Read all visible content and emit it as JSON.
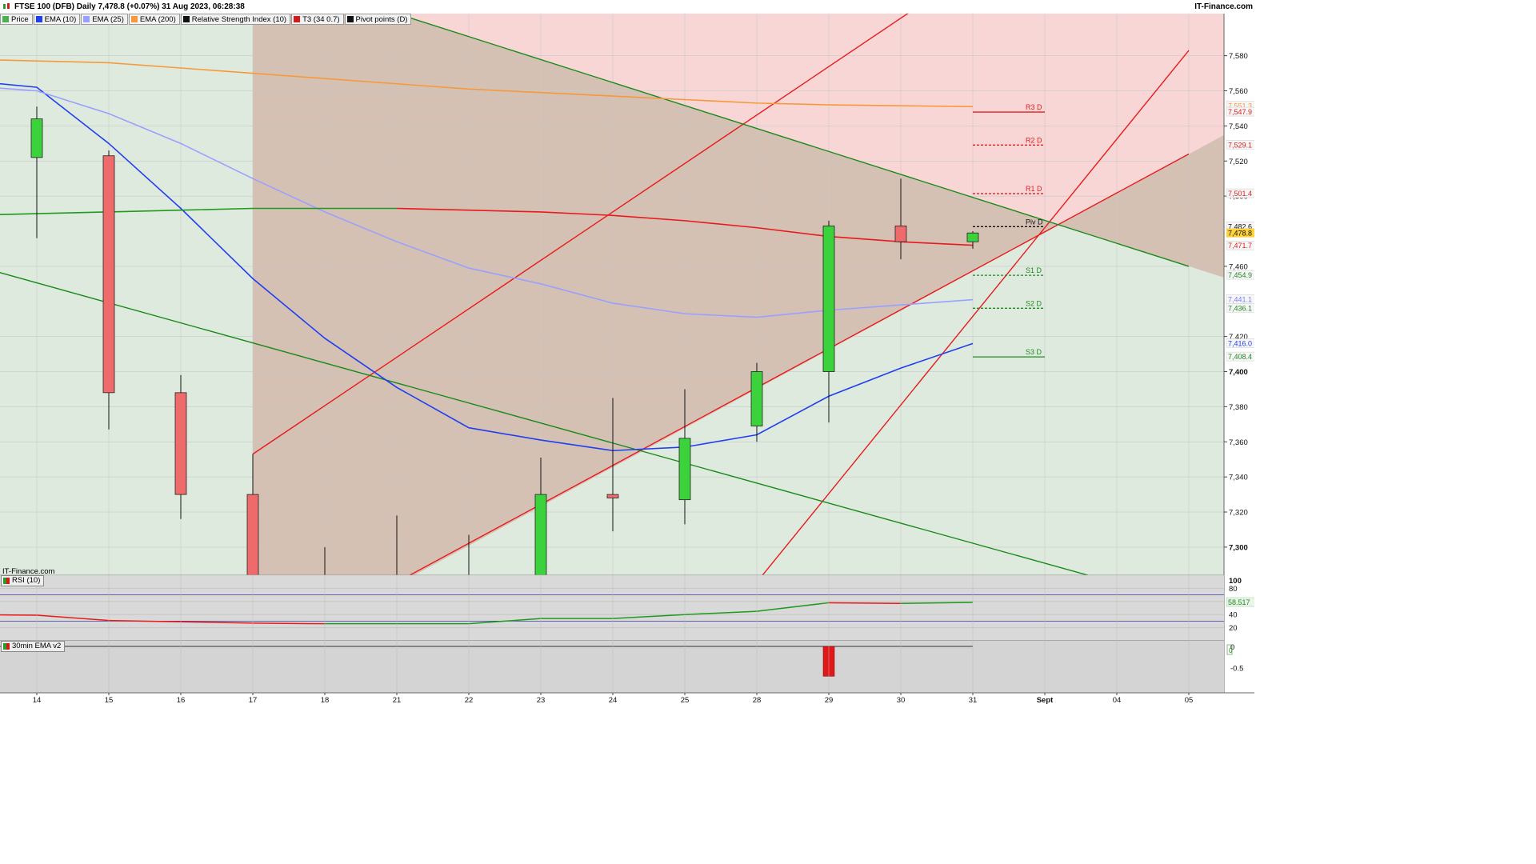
{
  "header": {
    "title": "FTSE 100 (DFB) Daily 7,478.8 (+0.07%) 31 Aug 2023, 06:28:38",
    "brand": "IT-Finance.com",
    "watermark": "IT-Finance.com"
  },
  "legend": [
    {
      "label": "Price",
      "color": "#4caf50",
      "icon": "price-swatch"
    },
    {
      "label": "EMA (10)",
      "color": "#1f3ff0",
      "icon": "ema10-swatch"
    },
    {
      "label": "EMA (25)",
      "color": "#9aa0ff",
      "icon": "ema25-swatch"
    },
    {
      "label": "EMA (200)",
      "color": "#f59a3a",
      "icon": "ema200-swatch"
    },
    {
      "label": "Relative Strength Index (10)",
      "color": "#111111",
      "icon": "rsi-swatch"
    },
    {
      "label": "T3 (34 0.7)",
      "color": "#d21c1c",
      "icon": "t3-swatch"
    },
    {
      "label": "Pivot points (D)",
      "color": "#111111",
      "icon": "pivot-swatch"
    }
  ],
  "panels": {
    "rsi_label": "RSI (10)",
    "ema30_label": "30min EMA v2"
  },
  "colors": {
    "up": "#3cd23c",
    "down": "#ef6b6b",
    "ema10": "#1f3ff0",
    "ema25": "#9aa0ff",
    "ema200": "#f59a3a",
    "t3_green": "#1f9a1f",
    "t3_red": "#e81a1a",
    "channel_red": "#e81a1a",
    "channel_green": "#1a8a1a",
    "pivot": "#111111",
    "resistance": "#e02020",
    "support": "#208a20",
    "zone_red": "#f9d6d6",
    "zone_green": "#dfeadf",
    "zone_overlap": "#d5c0b4",
    "rsi_bg": "#d9d9d9",
    "ema_panel_bg": "#d4d4d4"
  },
  "chart_data": [
    {
      "type": "candlestick",
      "title": "FTSE 100 (DFB) Daily",
      "x": [
        "14",
        "15",
        "16",
        "17",
        "18",
        "21",
        "22",
        "23",
        "24",
        "25",
        "28",
        "29",
        "30",
        "31",
        "Sept",
        "04",
        "05"
      ],
      "ylim": [
        7284,
        7604
      ],
      "yticks": [
        7300,
        7320,
        7340,
        7360,
        7380,
        7400,
        7420,
        7460,
        7500,
        7520,
        7540,
        7560,
        7580
      ],
      "ytick_labels": [
        "7,300",
        "7,320",
        "7,340",
        "7,360",
        "7,380",
        "7,400",
        "7,420",
        "7,460",
        "7,500",
        "7,520",
        "7,540",
        "7,560",
        "7,580"
      ],
      "candles": [
        {
          "x": "14",
          "open": 7522,
          "close": 7544,
          "high": 7551,
          "low": 7476
        },
        {
          "x": "15",
          "open": 7523,
          "close": 7388,
          "high": 7526,
          "low": 7367
        },
        {
          "x": "16",
          "open": 7388,
          "close": 7330,
          "high": 7398,
          "low": 7316
        },
        {
          "x": "17",
          "open": 7330,
          "close": 7280,
          "high": 7353,
          "low": 7270
        },
        {
          "x": "18",
          "open": 7280,
          "close": 7276,
          "high": 7300,
          "low": 7270
        },
        {
          "x": "21",
          "open": 7282,
          "close": 7280,
          "high": 7318,
          "low": 7270
        },
        {
          "x": "22",
          "open": 7282,
          "close": 7280,
          "high": 7307,
          "low": 7270
        },
        {
          "x": "23",
          "open": 7280,
          "close": 7330,
          "high": 7351,
          "low": 7270
        },
        {
          "x": "24",
          "open": 7330,
          "close": 7328,
          "high": 7385,
          "low": 7309
        },
        {
          "x": "25",
          "open": 7327,
          "close": 7362,
          "high": 7390,
          "low": 7313
        },
        {
          "x": "28",
          "open": 7369,
          "close": 7400,
          "high": 7405,
          "low": 7360
        },
        {
          "x": "29",
          "open": 7400,
          "close": 7483,
          "high": 7486,
          "low": 7371
        },
        {
          "x": "30",
          "open": 7483,
          "close": 7474,
          "high": 7510,
          "low": 7464
        },
        {
          "x": "31",
          "open": 7474,
          "close": 7479,
          "high": 7480,
          "low": 7470
        }
      ],
      "series": [
        {
          "name": "EMA (10)",
          "x": [
            "13",
            "14",
            "15",
            "16",
            "17",
            "18",
            "21",
            "22",
            "23",
            "24",
            "25",
            "28",
            "29",
            "30",
            "31"
          ],
          "values": [
            7566,
            7562,
            7530,
            7493,
            7453,
            7419,
            7391,
            7368,
            7361,
            7355,
            7357,
            7364,
            7386,
            7402,
            7416
          ]
        },
        {
          "name": "EMA (25)",
          "x": [
            "13",
            "14",
            "15",
            "16",
            "17",
            "18",
            "21",
            "22",
            "23",
            "24",
            "25",
            "28",
            "29",
            "30",
            "31"
          ],
          "values": [
            7563,
            7560,
            7547,
            7530,
            7510,
            7491,
            7474,
            7459,
            7450,
            7439,
            7433,
            7431,
            7435,
            7438,
            7441
          ]
        },
        {
          "name": "EMA (200)",
          "x": [
            "13",
            "14",
            "15",
            "16",
            "17",
            "18",
            "21",
            "22",
            "23",
            "24",
            "25",
            "28",
            "29",
            "30",
            "31"
          ],
          "values": [
            7578,
            7577,
            7576,
            7573,
            7570,
            7567,
            7564,
            7561,
            7559,
            7557,
            7555,
            7553,
            7552,
            7551.5,
            7551
          ]
        },
        {
          "name": "T3 (34 0.7)",
          "x": [
            "13",
            "14",
            "15",
            "16",
            "17",
            "18",
            "21",
            "22",
            "23",
            "24",
            "25",
            "28",
            "29",
            "30",
            "31"
          ],
          "values": [
            7489,
            7490,
            7491,
            7492,
            7493,
            7493,
            7493,
            7492,
            7491,
            7489,
            7486,
            7482,
            7477,
            7474,
            7472
          ]
        }
      ],
      "trendlines": [
        {
          "type": "red-channel-upper",
          "x": [
            "17",
            "31"
          ],
          "values": [
            7353,
            7629
          ]
        },
        {
          "type": "red-channel-lower",
          "x": [
            "21",
            "05"
          ],
          "values": [
            7280,
            7524
          ]
        },
        {
          "type": "red-channel-lower-2",
          "x": [
            "28",
            "05"
          ],
          "values": [
            7280,
            7583
          ]
        },
        {
          "type": "green-channel-upper",
          "x": [
            "21",
            "05"
          ],
          "values": [
            7604,
            7460
          ]
        },
        {
          "type": "green-channel-lower",
          "x": [
            "13",
            "05"
          ],
          "values": [
            7462,
            7268
          ]
        }
      ],
      "pivots": [
        {
          "label": "R3 D",
          "value": 7547.9,
          "style": "solid"
        },
        {
          "label": "R2 D",
          "value": 7529.1,
          "style": "dashed"
        },
        {
          "label": "R1 D",
          "value": 7501.4,
          "style": "dashed"
        },
        {
          "label": "Piv D",
          "value": 7482.6,
          "style": "dashed"
        },
        {
          "label": "S1 D",
          "value": 7454.9,
          "style": "dashed"
        },
        {
          "label": "S2 D",
          "value": 7436.1,
          "style": "dashed"
        },
        {
          "label": "S3 D",
          "value": 7408.4,
          "style": "solid"
        }
      ],
      "price_tags": [
        {
          "text": "7,551.3",
          "color": "#f59a3a",
          "value": 7551.3
        },
        {
          "text": "7,547.9",
          "color": "#e02020",
          "value": 7547.9
        },
        {
          "text": "7,529.1",
          "color": "#e02020",
          "value": 7529.1
        },
        {
          "text": "7,501.4",
          "color": "#e02020",
          "value": 7501.4
        },
        {
          "text": "7,482.6",
          "color": "#111111",
          "value": 7482.6
        },
        {
          "text": "7,478.8",
          "color": "#111111",
          "value": 7478.8,
          "highlight": true
        },
        {
          "text": "7,471.7",
          "color": "#e02020",
          "value": 7471.7
        },
        {
          "text": "7,454.9",
          "color": "#208a20",
          "value": 7454.9
        },
        {
          "text": "7,441.1",
          "color": "#7a80ff",
          "value": 7441.1
        },
        {
          "text": "7,436.1",
          "color": "#208a20",
          "value": 7436.1
        },
        {
          "text": "7,416.0",
          "color": "#1f3ff0",
          "value": 7416.0
        },
        {
          "text": "7,408.4",
          "color": "#208a20",
          "value": 7408.4
        }
      ]
    },
    {
      "type": "line",
      "title": "RSI (10)",
      "ylim": [
        0,
        100
      ],
      "yticks": [
        20,
        40,
        60,
        80,
        100
      ],
      "ytick_labels": [
        "20",
        "40",
        "60",
        "80",
        "100"
      ],
      "x": [
        "13",
        "14",
        "15",
        "16",
        "17",
        "18",
        "21",
        "22",
        "23",
        "24",
        "25",
        "28",
        "29",
        "30",
        "31"
      ],
      "values": [
        40,
        39,
        31,
        29,
        27,
        26,
        26,
        26,
        34,
        34,
        40,
        45,
        58,
        57,
        58.5
      ],
      "levels": [
        70,
        30
      ],
      "last_value_label": "58.517"
    },
    {
      "type": "bar",
      "title": "30min EMA v2",
      "yticks": [
        0,
        -0.5
      ],
      "ytick_labels": [
        "0",
        "-0.5"
      ],
      "x": [
        "29"
      ],
      "values": [
        -0.69
      ],
      "last_value_label": "0"
    }
  ]
}
